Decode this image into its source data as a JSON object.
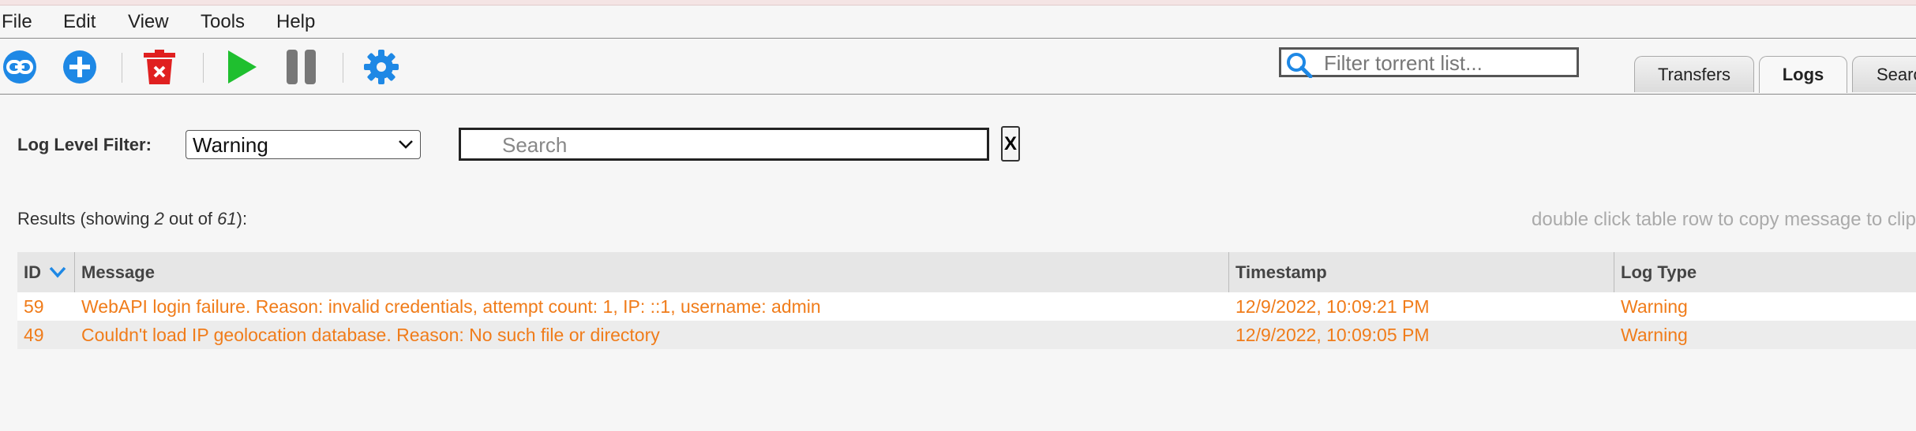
{
  "menu": [
    "File",
    "Edit",
    "View",
    "Tools",
    "Help"
  ],
  "toolbar": {
    "icons": [
      "link-icon",
      "add-icon",
      "delete-icon",
      "play-icon",
      "pause-icon",
      "settings-icon"
    ],
    "colors": {
      "blue": "#1e88e5",
      "red": "#e02020",
      "green": "#1fbf2f",
      "gray": "#777777"
    }
  },
  "filter": {
    "placeholder": "Filter torrent list..."
  },
  "tabs": [
    {
      "label": "Transfers",
      "active": false
    },
    {
      "label": "Logs",
      "active": true
    },
    {
      "label": "Search",
      "active": false
    }
  ],
  "logs": {
    "level_label": "Log Level Filter:",
    "level_value": "Warning",
    "search_placeholder": "Search",
    "clear_label": "X",
    "results_prefix": "Results (showing ",
    "results_shown": "2",
    "results_mid": " out of ",
    "results_total": "61",
    "results_suffix": "):",
    "hint": "double click table row to copy message to clipboard",
    "columns": [
      "ID",
      "Message",
      "Timestamp",
      "Log Type"
    ],
    "sort_indicator": "chevron-down-icon",
    "row_color": "#f07c1a",
    "rows": [
      {
        "id": "59",
        "message": "WebAPI login failure. Reason: invalid credentials, attempt count: 1, IP: ::1, username: admin",
        "timestamp": "12/9/2022, 10:09:21 PM",
        "type": "Warning"
      },
      {
        "id": "49",
        "message": "Couldn't load IP geolocation database. Reason: No such file or directory",
        "timestamp": "12/9/2022, 10:09:05 PM",
        "type": "Warning"
      }
    ]
  }
}
